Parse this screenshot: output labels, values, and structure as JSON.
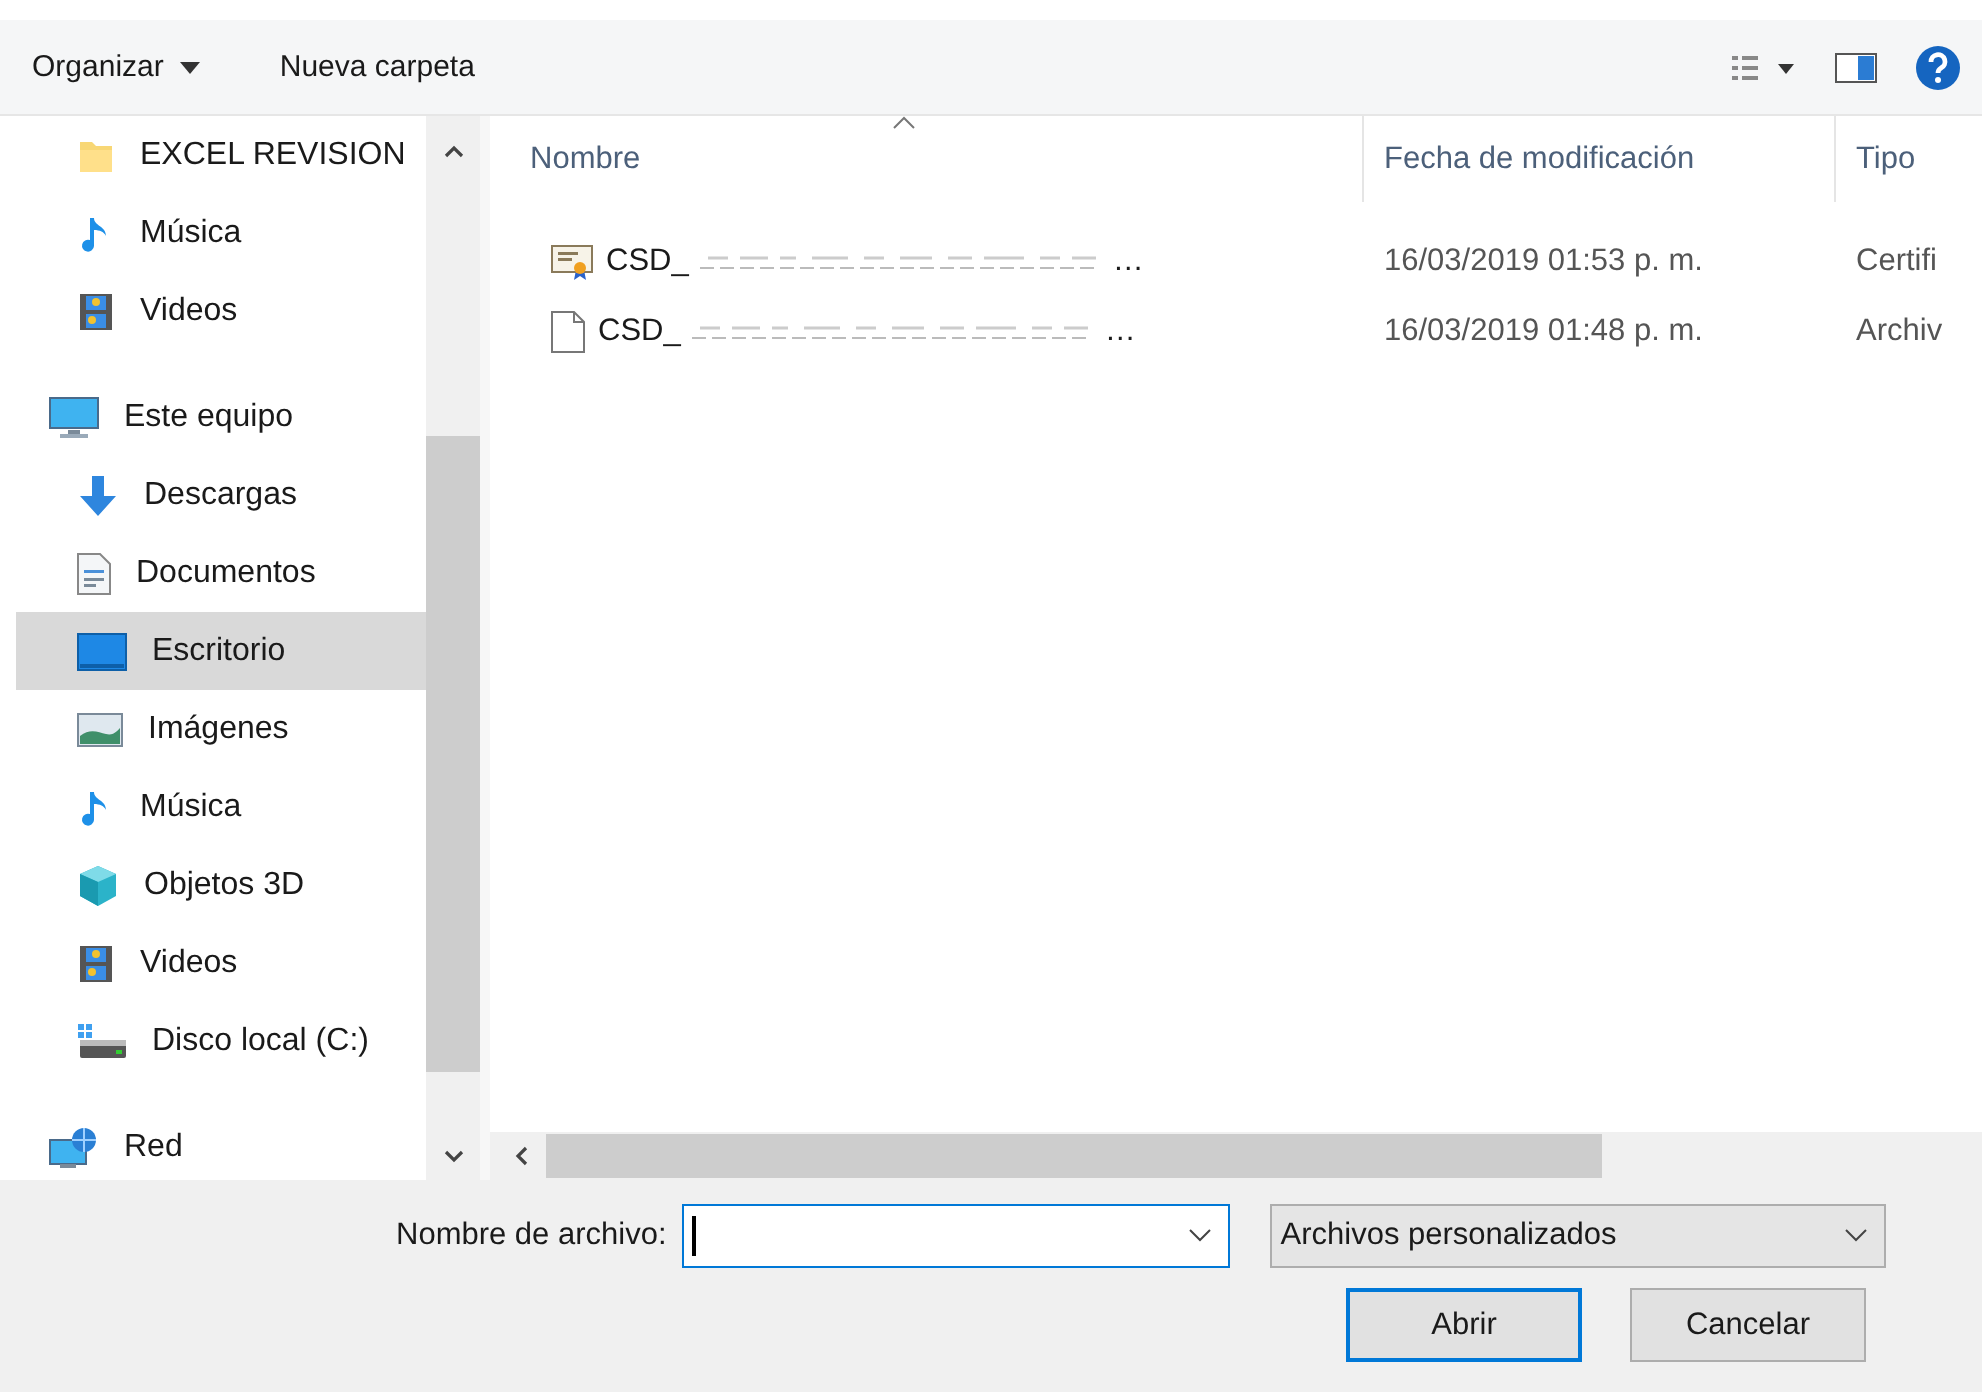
{
  "toolbar": {
    "buttons": [
      {
        "label": "Organizar",
        "kind": "menu"
      },
      {
        "label": "Nueva carpeta",
        "kind": "plain"
      }
    ]
  },
  "sidebar": {
    "pinned_items": [
      {
        "label": "EXCEL REVISION",
        "kind": "folder",
        "selected": false
      },
      {
        "label": "Música",
        "kind": "music",
        "selected": false
      },
      {
        "label": "Videos",
        "kind": "video",
        "selected": false
      }
    ],
    "tree": [
      {
        "label": "Este equipo",
        "kind": "computer",
        "selected": false,
        "children": [
          {
            "label": "Descargas",
            "kind": "download",
            "selected": false
          },
          {
            "label": "Documentos",
            "kind": "document",
            "selected": false
          },
          {
            "label": "Escritorio",
            "kind": "desktop",
            "selected": true
          },
          {
            "label": "Imágenes",
            "kind": "image",
            "selected": false
          },
          {
            "label": "Música",
            "kind": "music",
            "selected": false
          },
          {
            "label": "Objetos 3D",
            "kind": "cube",
            "selected": false
          },
          {
            "label": "Videos",
            "kind": "video",
            "selected": false
          },
          {
            "label": "Disco local (C:)",
            "kind": "drive",
            "selected": false
          }
        ]
      },
      {
        "label": "Red",
        "kind": "network",
        "selected": false
      }
    ]
  },
  "table": {
    "columns": [
      {
        "label": "Nombre",
        "sorted": true
      },
      {
        "label": "Fecha de modificación",
        "sorted": false
      },
      {
        "label": "Tipo",
        "sorted": false
      }
    ],
    "rows": [
      {
        "kind": "certificate",
        "name_start": "CSD_",
        "name_end": "…",
        "date": "16/03/2019 01:53 p. m.",
        "type": "Certifi"
      },
      {
        "kind": "file",
        "name_start": "CSD_",
        "name_end": "…",
        "date": "16/03/2019 01:48 p. m.",
        "type": "Archiv"
      }
    ]
  },
  "footer": {
    "filename_label": "Nombre de archivo:",
    "filter": "Archivos personalizados",
    "buttons": [
      {
        "label": "Abrir",
        "default": true
      },
      {
        "label": "Cancelar",
        "default": false
      }
    ]
  }
}
